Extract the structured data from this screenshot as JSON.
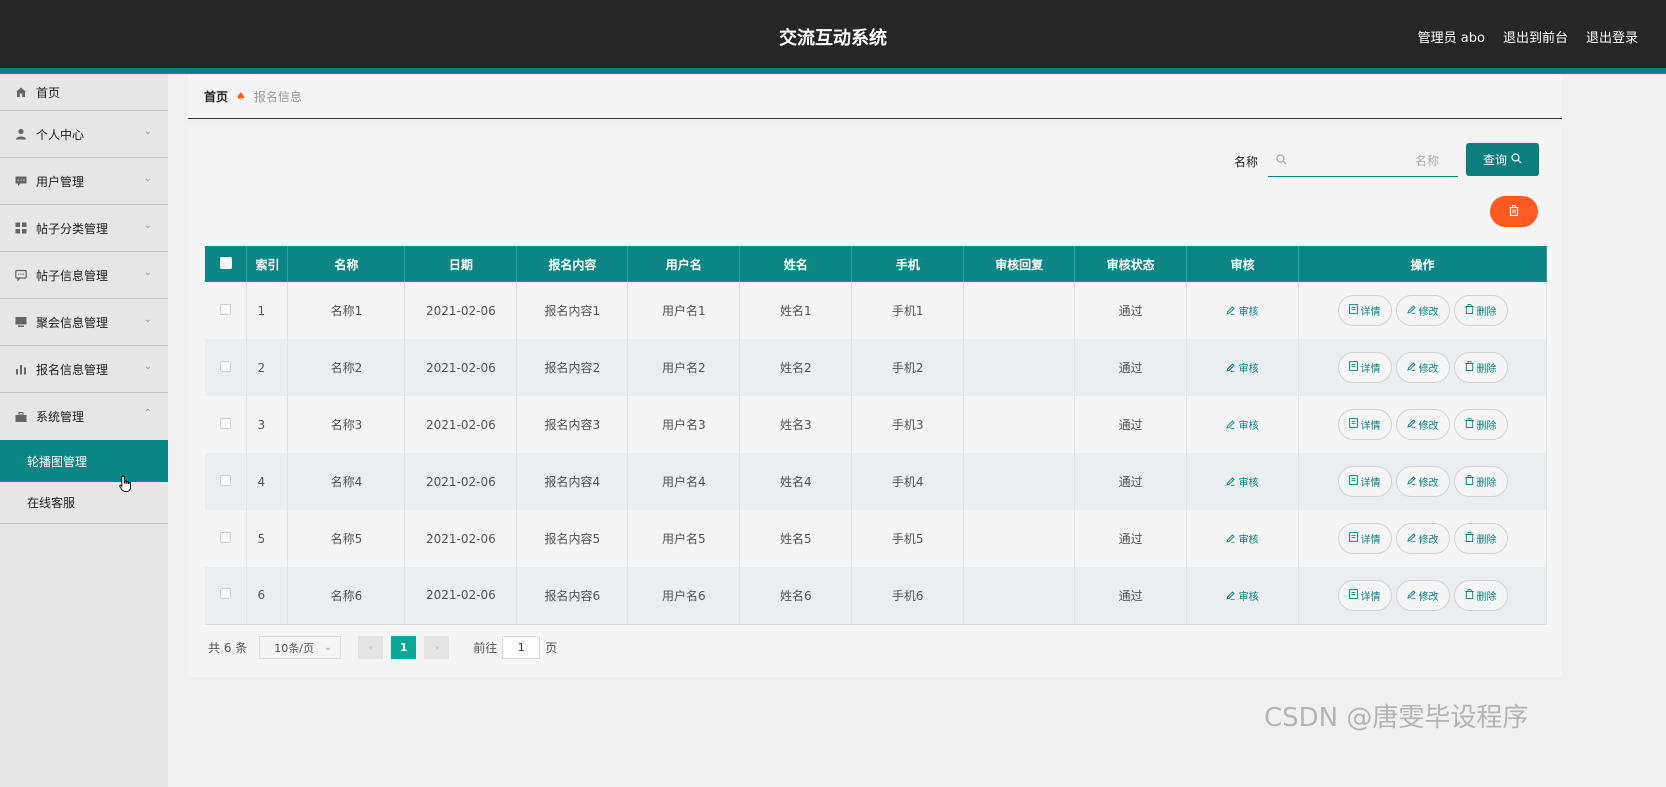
{
  "header": {
    "title": "交流互动系统",
    "user_label": "管理员 abo",
    "back_front": "退出到前台",
    "logout": "退出登录"
  },
  "sidebar": {
    "items": [
      {
        "label": "首页",
        "icon": "home-icon"
      },
      {
        "label": "个人中心",
        "icon": "user-icon"
      },
      {
        "label": "用户管理",
        "icon": "chat-icon"
      },
      {
        "label": "帖子分类管理",
        "icon": "grid-icon"
      },
      {
        "label": "帖子信息管理",
        "icon": "message-icon"
      },
      {
        "label": "聚会信息管理",
        "icon": "monitor-icon"
      },
      {
        "label": "报名信息管理",
        "icon": "bar-chart-icon"
      },
      {
        "label": "系统管理",
        "icon": "briefcase-icon"
      }
    ],
    "subitems": [
      {
        "label": "轮播图管理",
        "active": true
      },
      {
        "label": "在线客服",
        "active": false
      }
    ]
  },
  "breadcrumb": {
    "home": "首页",
    "current": "报名信息"
  },
  "search": {
    "label": "名称",
    "placeholder": "名称",
    "button": "查询"
  },
  "table": {
    "headers": [
      "索引",
      "名称",
      "日期",
      "报名内容",
      "用户名",
      "姓名",
      "手机",
      "审核回复",
      "审核状态",
      "审核",
      "操作"
    ],
    "rows": [
      {
        "index": "1",
        "name": "名称1",
        "date": "2021-02-06",
        "content": "报名内容1",
        "username": "用户名1",
        "realname": "姓名1",
        "phone": "手机1",
        "reply": "",
        "status": "通过"
      },
      {
        "index": "2",
        "name": "名称2",
        "date": "2021-02-06",
        "content": "报名内容2",
        "username": "用户名2",
        "realname": "姓名2",
        "phone": "手机2",
        "reply": "",
        "status": "通过"
      },
      {
        "index": "3",
        "name": "名称3",
        "date": "2021-02-06",
        "content": "报名内容3",
        "username": "用户名3",
        "realname": "姓名3",
        "phone": "手机3",
        "reply": "",
        "status": "通过"
      },
      {
        "index": "4",
        "name": "名称4",
        "date": "2021-02-06",
        "content": "报名内容4",
        "username": "用户名4",
        "realname": "姓名4",
        "phone": "手机4",
        "reply": "",
        "status": "通过"
      },
      {
        "index": "5",
        "name": "名称5",
        "date": "2021-02-06",
        "content": "报名内容5",
        "username": "用户名5",
        "realname": "姓名5",
        "phone": "手机5",
        "reply": "",
        "status": "通过"
      },
      {
        "index": "6",
        "name": "名称6",
        "date": "2021-02-06",
        "content": "报名内容6",
        "username": "用户名6",
        "realname": "姓名6",
        "phone": "手机6",
        "reply": "",
        "status": "通过"
      }
    ],
    "audit_label": "审核",
    "detail_label": "详情",
    "edit_label": "修改",
    "delete_label": "删除"
  },
  "pagination": {
    "total": "共 6 条",
    "page_size": "10条/页",
    "current_page": "1",
    "goto_prefix": "前往",
    "goto_value": "1",
    "goto_suffix": "页"
  },
  "watermark": "CSDN @唐雯毕设程序",
  "colors": {
    "primary": "#0b7f7f",
    "danger": "#ff5a1f",
    "header_bg": "#262626"
  }
}
